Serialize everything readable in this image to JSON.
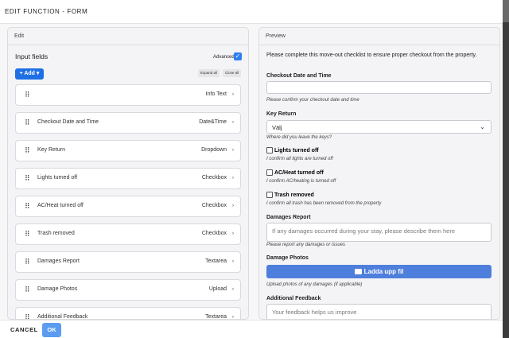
{
  "window": {
    "title": "EDIT FUNCTION - FORM"
  },
  "edit_panel": {
    "heading": "Edit",
    "input_fields_label": "Input fields",
    "advanced_label": "Advanced",
    "advanced_checked": true,
    "add_label": "+ Add ▾",
    "expand_all_label": "Expand all",
    "close_all_label": "Close all",
    "fields": [
      {
        "name": "",
        "type": "Info Text"
      },
      {
        "name": "Checkout Date and Time",
        "type": "Date&Time"
      },
      {
        "name": "Key Return",
        "type": "Dropdown"
      },
      {
        "name": "Lights turned off",
        "type": "Checkbox"
      },
      {
        "name": "AC/Heat turned off",
        "type": "Checkbox"
      },
      {
        "name": "Trash removed",
        "type": "Checkbox"
      },
      {
        "name": "Damages Report",
        "type": "Textarea"
      },
      {
        "name": "Damage Photos",
        "type": "Upload"
      },
      {
        "name": "Additional Feedback",
        "type": "Textarea"
      }
    ]
  },
  "preview_panel": {
    "heading": "Preview",
    "intro": "Please complete this move-out checklist to ensure proper checkout from the property.",
    "checkout": {
      "label": "Checkout Date and Time",
      "help": "Please confirm your checkout date and time"
    },
    "key_return": {
      "label": "Key Return",
      "selected": "Välj",
      "help": "Where did you leave the keys?"
    },
    "lights": {
      "label": "Lights turned off",
      "help": "I confirm all lights are turned off"
    },
    "ac": {
      "label": "AC/Heat turned off",
      "help": "I confirm AC/heating is turned off"
    },
    "trash": {
      "label": "Trash removed",
      "help": "I confirm all trash has been removed from the property"
    },
    "damages": {
      "label": "Damages Report",
      "placeholder": "If any damages occurred during your stay, please describe them here",
      "help": "Please report any damages or issues"
    },
    "photos": {
      "label": "Damage Photos",
      "button": "Ladda upp fil",
      "help": "Upload photos of any damages (if applicable)"
    },
    "feedback": {
      "label": "Additional Feedback",
      "placeholder": "Your feedback helps us improve"
    }
  },
  "footer": {
    "cancel_label": "CANCEL",
    "ok_label": "OK"
  },
  "colors": {
    "primary": "#1f6fe5",
    "upload": "#4f7fdc",
    "ok": "#5b9cf0"
  }
}
